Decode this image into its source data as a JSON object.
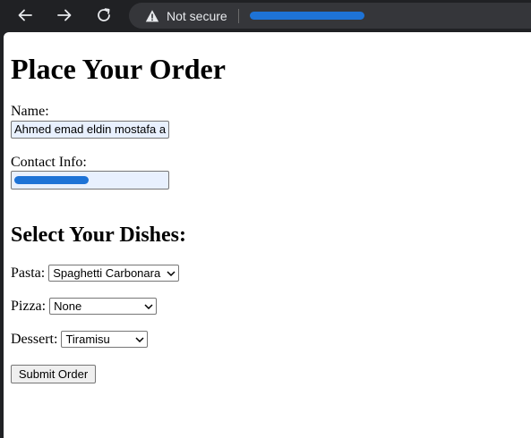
{
  "browser": {
    "security_text": "Not secure",
    "url": ""
  },
  "form": {
    "title": "Place Your Order",
    "name_label": "Name:",
    "name_value": "Ahmed emad eldin mostafa a",
    "contact_label": "Contact Info:",
    "contact_value": "",
    "dishes_heading": "Select Your Dishes:",
    "pasta_label": "Pasta:",
    "pasta_selected": "Spaghetti Carbonara",
    "pizza_label": "Pizza:",
    "pizza_selected": "None",
    "dessert_label": "Dessert:",
    "dessert_selected": "Tiramisu",
    "submit_label": "Submit Order"
  },
  "colors": {
    "autofill_bg": "#e8f0fe",
    "redaction": "#1e73d6",
    "toolbar_bg": "#202124",
    "omnibox_bg": "#35363a"
  },
  "icons": [
    "back-arrow-icon",
    "forward-arrow-icon",
    "reload-icon",
    "warning-icon",
    "chevron-down-icon"
  ]
}
